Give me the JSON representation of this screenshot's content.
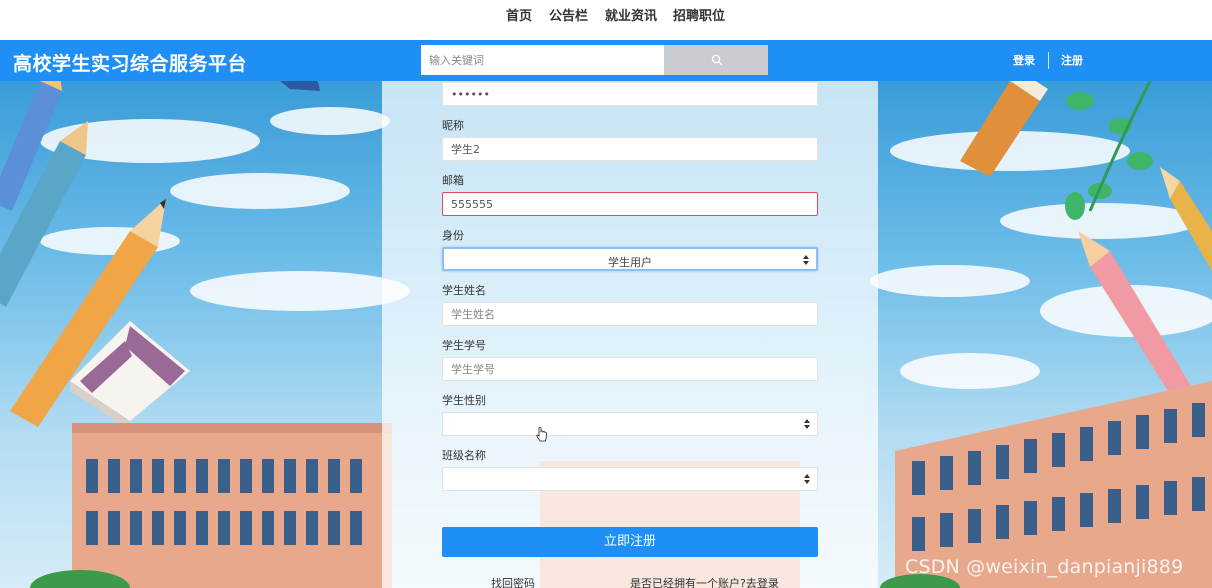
{
  "nav": {
    "links": [
      "首页",
      "公告栏",
      "就业资讯",
      "招聘职位"
    ]
  },
  "header": {
    "title": "高校学生实习综合服务平台",
    "search_placeholder": "输入关键词",
    "login_label": "登录",
    "register_label": "注册"
  },
  "form": {
    "password_value": "••••••",
    "nickname": {
      "label": "昵称",
      "value": "学生2"
    },
    "email": {
      "label": "邮箱",
      "value": "555555"
    },
    "identity": {
      "label": "身份",
      "selected": "学生用户"
    },
    "student_name": {
      "label": "学生姓名",
      "placeholder": "学生姓名"
    },
    "student_id": {
      "label": "学生学号",
      "placeholder": "学生学号"
    },
    "gender": {
      "label": "学生性别",
      "selected": ""
    },
    "class_name": {
      "label": "班级名称",
      "selected": ""
    },
    "submit_label": "立即注册",
    "forgot_password": "找回密码",
    "login_prompt": "是否已经拥有一个账户?去登录"
  },
  "watermark": "CSDN @weixin_danpianji889",
  "colors": {
    "brand_blue": "#1f8ef5",
    "error_red": "#e4475b",
    "search_btn_gray": "#c9ccd1"
  }
}
